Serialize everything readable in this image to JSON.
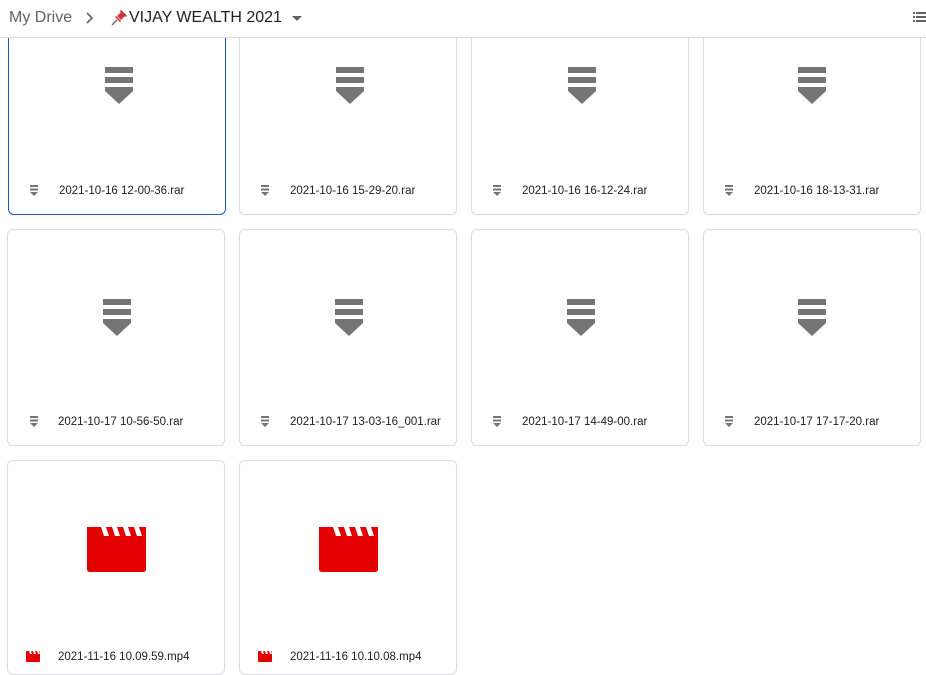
{
  "breadcrumb": {
    "root": "My Drive",
    "current": "VIJAY WEALTH 2021"
  },
  "icons": {
    "pin": "pushpin-icon",
    "separator": "chevron-right-icon",
    "dropdown": "caret-down-icon",
    "view": "list-view-icon",
    "archive": "archive-file-icon",
    "video": "video-clapperboard-icon"
  },
  "colors": {
    "archive_icon": "#757575",
    "video_icon": "#e50000",
    "selected_border": "#1a57c4"
  },
  "files": [
    {
      "name": "2021-10-16 12-00-36.rar",
      "type": "rar",
      "selected": true
    },
    {
      "name": "2021-10-16 15-29-20.rar",
      "type": "rar"
    },
    {
      "name": "2021-10-16 16-12-24.rar",
      "type": "rar"
    },
    {
      "name": "2021-10-16 18-13-31.rar",
      "type": "rar"
    },
    {
      "name": "2021-10-17 10-56-50.rar",
      "type": "rar"
    },
    {
      "name": "2021-10-17 13-03-16_001.rar",
      "type": "rar"
    },
    {
      "name": "2021-10-17 14-49-00.rar",
      "type": "rar"
    },
    {
      "name": "2021-10-17 17-17-20.rar",
      "type": "rar"
    },
    {
      "name": "2021-11-16 10.09.59.mp4",
      "type": "mp4"
    },
    {
      "name": "2021-11-16 10.10.08.mp4",
      "type": "mp4"
    }
  ]
}
